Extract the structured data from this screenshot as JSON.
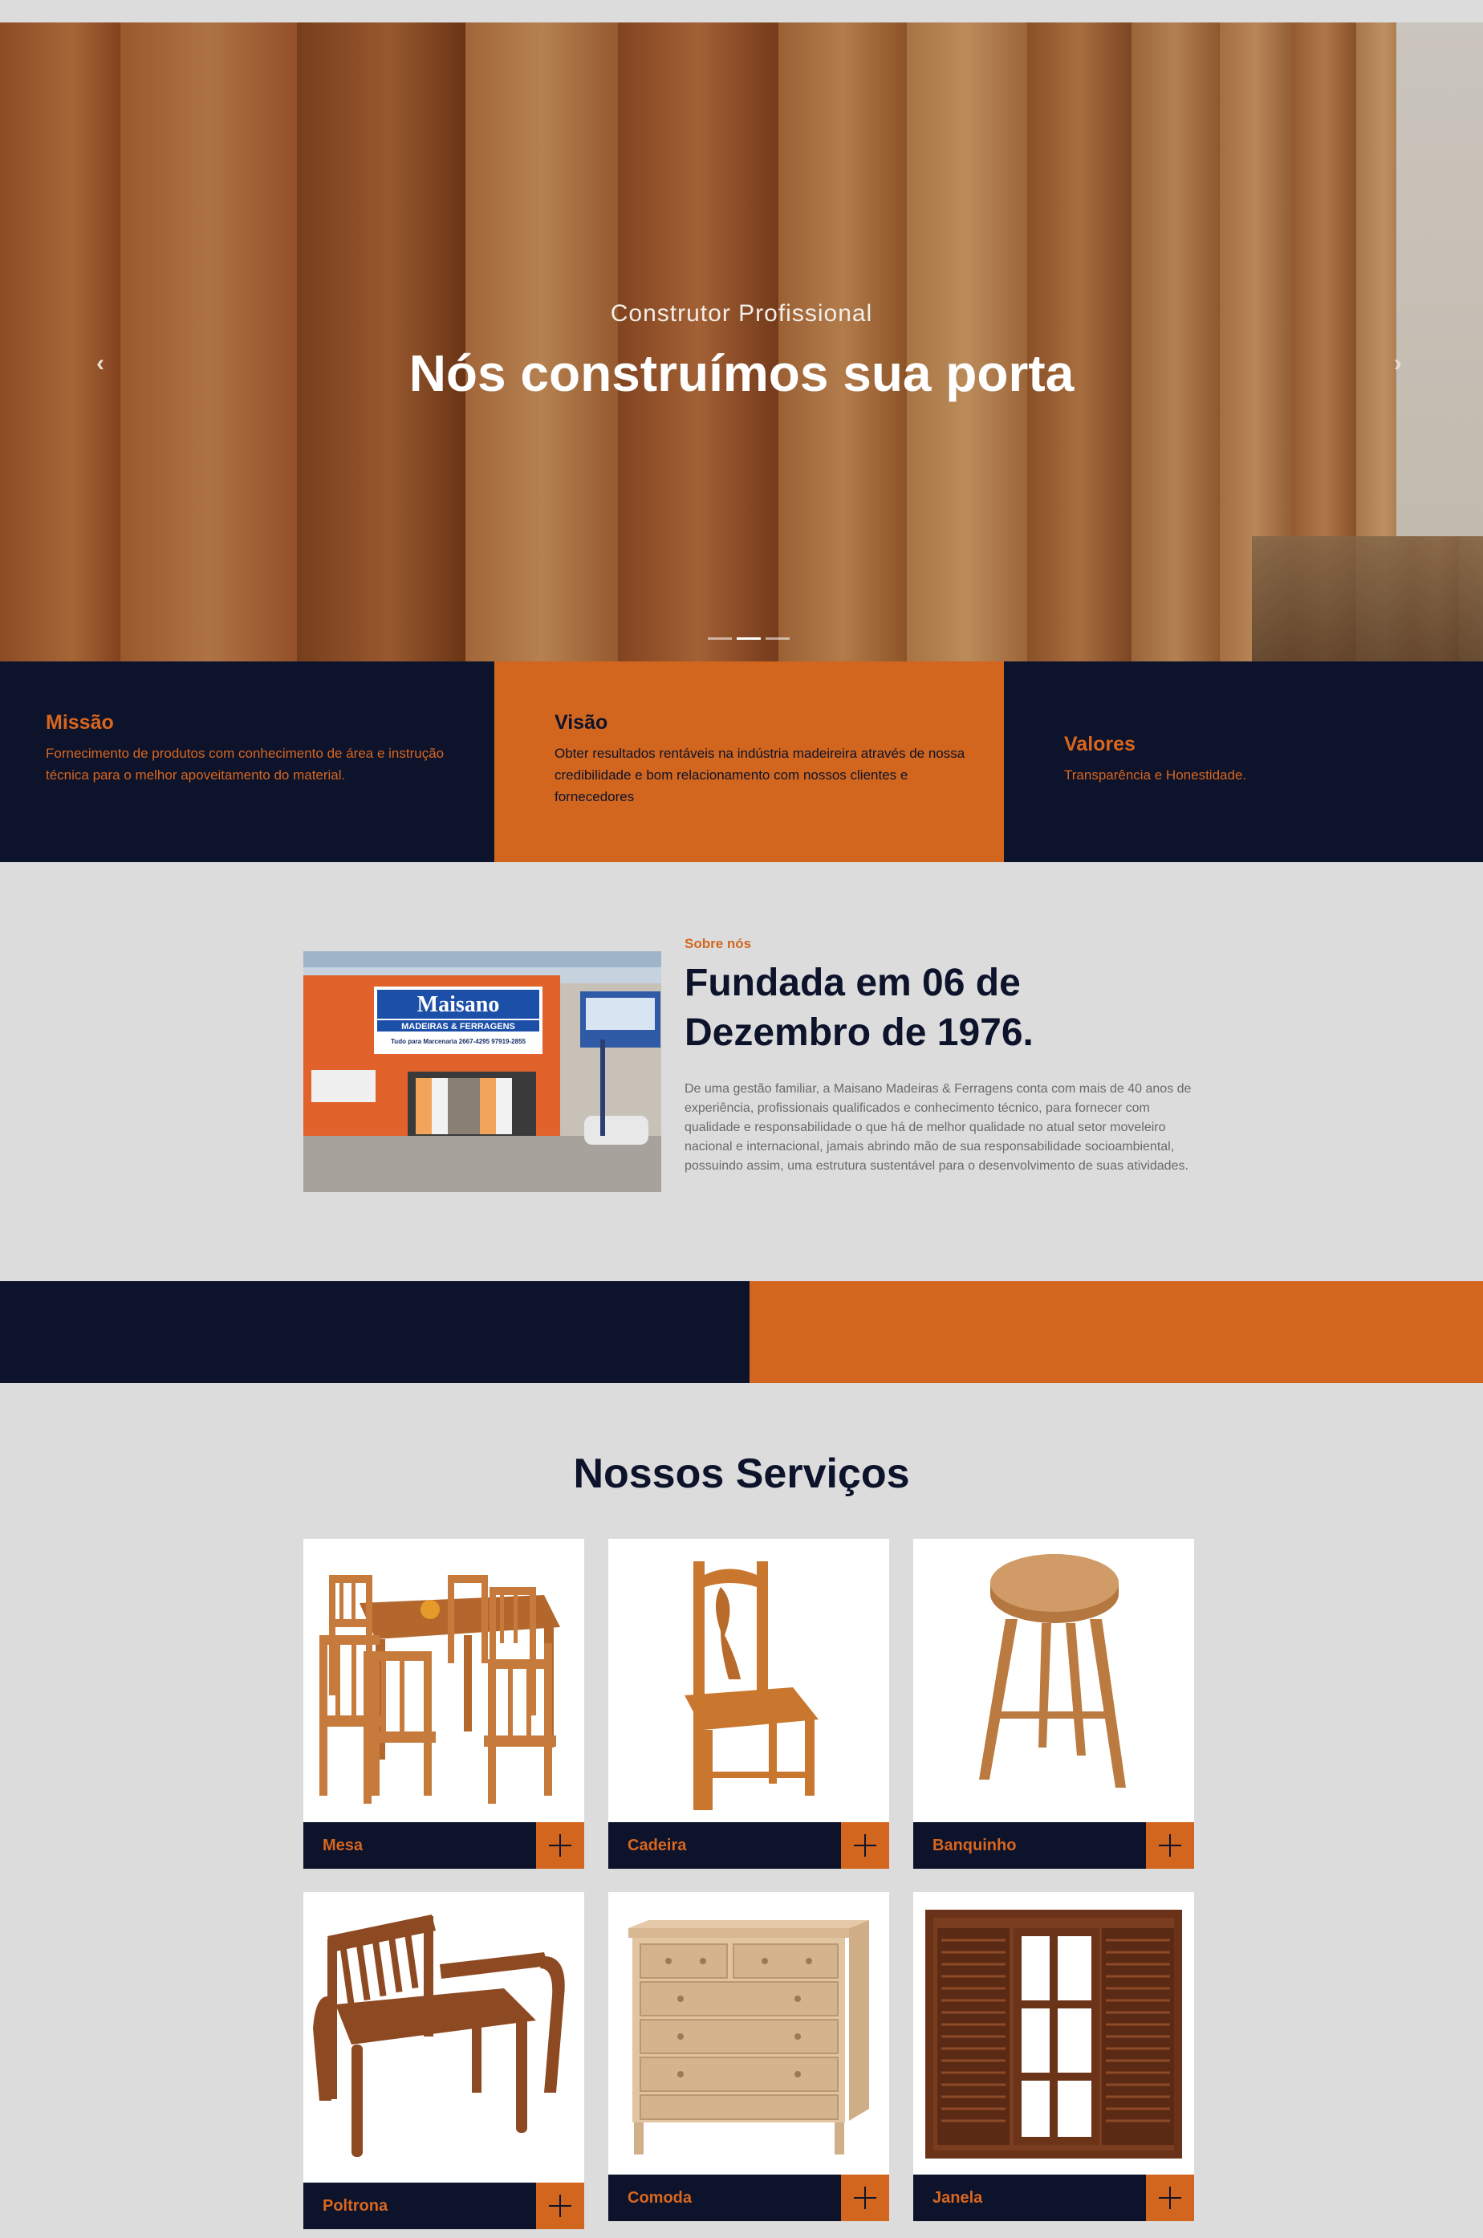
{
  "hero": {
    "subtitle": "Construtor Profissional",
    "title": "Nós construímos sua porta",
    "prev_label": "‹",
    "next_label": "›",
    "slides": 3,
    "active_slide": 2
  },
  "mvv": [
    {
      "title": "Missão",
      "text": "Fornecimento de produtos com conhecimento de área e instrução técnica para o melhor apoveitamento do material."
    },
    {
      "title": "Visão",
      "text": "Obter resultados rentáveis na indústria madeireira através de nossa credibilidade e bom relacionamento com nossos clientes e fornecedores"
    },
    {
      "title": "Valores",
      "text": "Transparência e Honestidade."
    }
  ],
  "about": {
    "kicker": "Sobre nós",
    "title": "Fundada em 06 de Dezembro de 1976.",
    "text": "De uma gestão familiar, a Maisano Madeiras & Ferragens conta com mais de 40 anos de experiência, profissionais qualificados e conhecimento técnico, para fornecer com qualidade e responsabilidade o que há de melhor qualidade no atual setor moveleiro nacional e internacional, jamais abrindo mão de sua responsabilidade socioambiental, possuindo assim, uma estrutura sustentável para o desenvolvimento de suas atividades.",
    "storefront": {
      "sign_name": "Maisano",
      "sign_sub": "MADEIRAS & FERRAGENS",
      "sign_tag": "Tudo para Marcenaria   2667-4295   97919-2855"
    }
  },
  "services": {
    "title": "Nossos Serviços",
    "items": [
      {
        "label": "Mesa",
        "icon": "dining-table-image"
      },
      {
        "label": "Cadeira",
        "icon": "chair-image"
      },
      {
        "label": "Banquinho",
        "icon": "stool-image"
      },
      {
        "label": "Poltrona",
        "icon": "bench-image"
      },
      {
        "label": "Comoda",
        "icon": "dresser-image"
      },
      {
        "label": "Janela",
        "icon": "window-image"
      }
    ]
  },
  "colors": {
    "navy": "#0c132b",
    "orange": "#d2661f",
    "background": "#dcdcdc"
  }
}
